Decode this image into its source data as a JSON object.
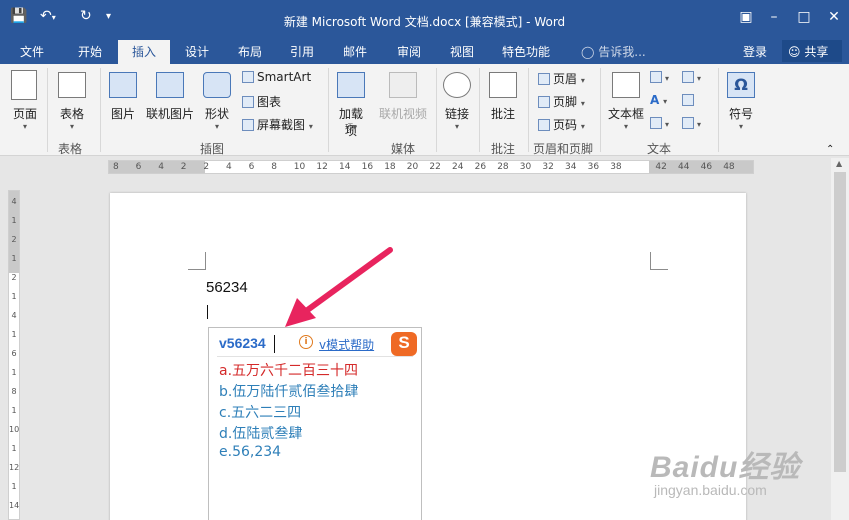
{
  "window": {
    "title": "新建 Microsoft Word 文档.docx [兼容模式] - Word",
    "colors": {
      "brand": "#2b579a",
      "ribbon_bg": "#f3f3f3",
      "selected_candidate": "#d42a2a",
      "candidate": "#2e7fb8",
      "arrow": "#e8245e"
    }
  },
  "tabs": [
    {
      "label": "文件"
    },
    {
      "label": "开始"
    },
    {
      "label": "插入"
    },
    {
      "label": "设计"
    },
    {
      "label": "布局"
    },
    {
      "label": "引用"
    },
    {
      "label": "邮件"
    },
    {
      "label": "审阅"
    },
    {
      "label": "视图"
    },
    {
      "label": "特色功能"
    }
  ],
  "active_tab": "插入",
  "tellme": "告诉我...",
  "account": {
    "login": "登录",
    "share": "共享"
  },
  "ribbon": {
    "page": "页面",
    "table": "表格",
    "picture": "图片",
    "online_picture": "联机图片",
    "shapes": "形状",
    "smartart": "SmartArt",
    "chart": "图表",
    "screenshot": "屏幕截图",
    "addins": "加载项",
    "online_video": "联机视频",
    "link": "链接",
    "comment": "批注",
    "header": "页眉",
    "footer": "页脚",
    "page_number": "页码",
    "textbox": "文本框",
    "symbol": "符号"
  },
  "groups": {
    "table": "表格",
    "illustrations": "插图",
    "media": "媒体",
    "comments": "批注",
    "header_footer": "页眉和页脚",
    "text": "文本"
  },
  "ruler_numbers": [
    "8",
    "6",
    "4",
    "2",
    "2",
    "4",
    "6",
    "8",
    "10",
    "12",
    "14",
    "16",
    "18",
    "20",
    "22",
    "24",
    "26",
    "28",
    "30",
    "32",
    "34",
    "36",
    "38",
    "42",
    "44",
    "46",
    "48"
  ],
  "vruler_numbers": [
    "4",
    "1",
    "2",
    "1",
    "2",
    "1",
    "4",
    "1",
    "6",
    "1",
    "8",
    "1",
    "10",
    "1",
    "12",
    "1",
    "14"
  ],
  "document": {
    "typed_text": "56234"
  },
  "ime": {
    "input": "v56234",
    "help_link": "v模式帮助",
    "logo": "S",
    "candidates": [
      {
        "label": "a.",
        "text": "五万六千二百三十四"
      },
      {
        "label": "b.",
        "text": "伍万陆仟贰佰叁拾肆"
      },
      {
        "label": "c.",
        "text": "五六二三四"
      },
      {
        "label": "d.",
        "text": "伍陆贰叁肆"
      },
      {
        "label": "e.",
        "text": "56,234"
      }
    ],
    "selected_index": 0
  },
  "watermark": {
    "brand": "Baidu经验",
    "url": "jingyan.baidu.com"
  }
}
